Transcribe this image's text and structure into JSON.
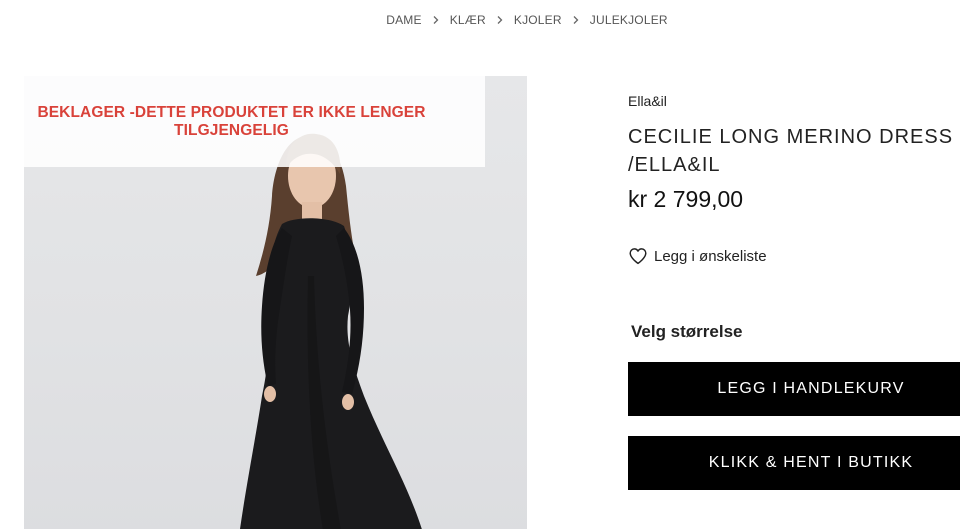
{
  "breadcrumb": {
    "items": [
      "DAME",
      "KLÆR",
      "KJOLER",
      "JULEKJOLER"
    ]
  },
  "image": {
    "unavailable_notice": "BEKLAGER -DETTE PRODUKTET ER IKKE LENGER TILGJENGELIG",
    "notice_color": "#d9423a"
  },
  "product": {
    "brand": "Ella&il",
    "title": "CECILIE LONG MERINO DRESS /ELLA&IL",
    "price": "kr 2 799,00"
  },
  "wishlist": {
    "label": "Legg i ønskeliste",
    "icon": "heart-outline-icon"
  },
  "size": {
    "label": "Velg størrelse"
  },
  "buttons": {
    "add_to_cart": "LEGG I HANDLEKURV",
    "click_collect": "KLIKK & HENT I BUTIKK"
  }
}
